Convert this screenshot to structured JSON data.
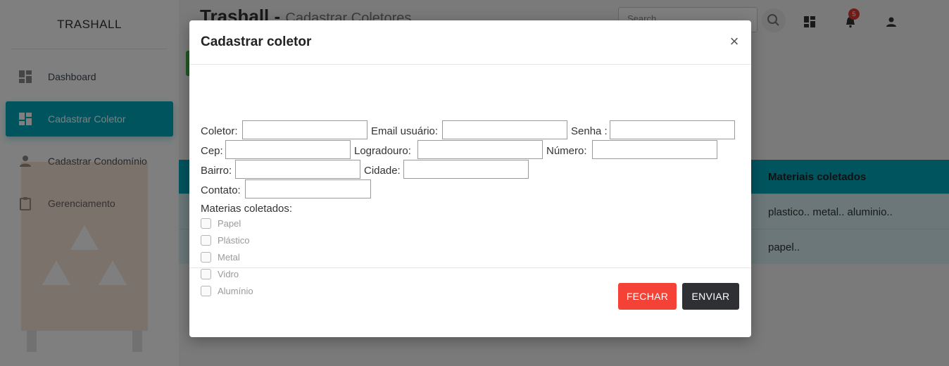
{
  "sidebar": {
    "brand": "TRASHALL",
    "items": [
      {
        "label": "Dashboard",
        "icon": "dashboard-icon",
        "active": false
      },
      {
        "label": "Cadastrar Coletor",
        "icon": "dashboard-icon",
        "active": true
      },
      {
        "label": "Cadastrar Condomínio",
        "icon": "person-icon",
        "active": false
      },
      {
        "label": "Gerenciamento",
        "icon": "clipboard-icon",
        "active": false
      }
    ]
  },
  "header": {
    "title": "Trashall -",
    "subtitle": "Cadastrar Coletores",
    "search_placeholder": "Search",
    "notification_count": "5"
  },
  "table": {
    "column_header": "Materiais coletados",
    "rows": [
      "plastico.. metal.. aluminio..",
      "papel.."
    ]
  },
  "modal": {
    "title": "Cadastrar coletor",
    "close_symbol": "×",
    "fields": {
      "coletor": "Coletor:",
      "email": "Email usuário:",
      "senha": "Senha :",
      "cep": "Cep:",
      "logradouro": "Logradouro:",
      "numero": "Número:",
      "bairro": "Bairro:",
      "cidade": "Cidade:",
      "contato": "Contato:"
    },
    "materials_label": "Materias coletados:",
    "materials": [
      "Papel",
      "Plástico",
      "Metal",
      "Vidro",
      "Alumínio"
    ],
    "buttons": {
      "close": "FECHAR",
      "send": "ENVIAR"
    }
  },
  "colors": {
    "accent": "#00a8bd",
    "close_button": "#f44336",
    "send_button": "#2e3034",
    "badge": "#e53935"
  }
}
